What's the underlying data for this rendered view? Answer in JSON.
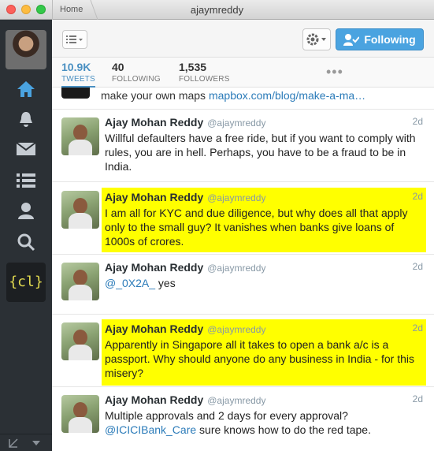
{
  "window": {
    "title": "ajaymreddy",
    "home_tab": "Home"
  },
  "toolbar": {
    "following_label": "Following"
  },
  "stats": [
    {
      "num": "10.9K",
      "label": "TWEETS"
    },
    {
      "num": "40",
      "label": "FOLLOWING"
    },
    {
      "num": "1,535",
      "label": "FOLLOWERS"
    }
  ],
  "more_label": "•••",
  "sidebar": {
    "cl_label": "{cl}"
  },
  "partial_tweet": {
    "text": "make your own maps ",
    "link": "mapbox.com/blog/make-a-ma…"
  },
  "tweets": [
    {
      "name": "Ajay Mohan Reddy",
      "handle": "@ajaymreddy",
      "time": "2d",
      "highlighted": false,
      "text": "Willful defaulters have a free ride, but if you want to comply with rules, you are in hell. Perhaps, you have to be a fraud to be in India."
    },
    {
      "name": "Ajay Mohan Reddy",
      "handle": "@ajaymreddy",
      "time": "2d",
      "highlighted": true,
      "text": "I am all for KYC and due diligence, but why does all that apply only to the small guy? It vanishes when banks give loans of 1000s of crores."
    },
    {
      "name": "Ajay Mohan Reddy",
      "handle": "@ajaymreddy",
      "time": "2d",
      "highlighted": false,
      "mention": "@_0X2A_",
      "text": " yes"
    },
    {
      "name": "Ajay Mohan Reddy",
      "handle": "@ajaymreddy",
      "time": "2d",
      "highlighted": true,
      "text": "Apparently in Singapore all it takes to open a bank a/c is a passport. Why should anyone do any business in India - for this misery?"
    },
    {
      "name": "Ajay Mohan Reddy",
      "handle": "@ajaymreddy",
      "time": "2d",
      "highlighted": false,
      "text_pre": "Multiple approvals and 2 days for every approval? ",
      "mention": "@ICICIBank_Care",
      "text": " sure knows how to do the red tape."
    }
  ],
  "colors": {
    "highlight": "#ffff00",
    "link": "#2b7bb9",
    "sidebar": "#2b3035",
    "follow_button": "#4aa3e0"
  }
}
